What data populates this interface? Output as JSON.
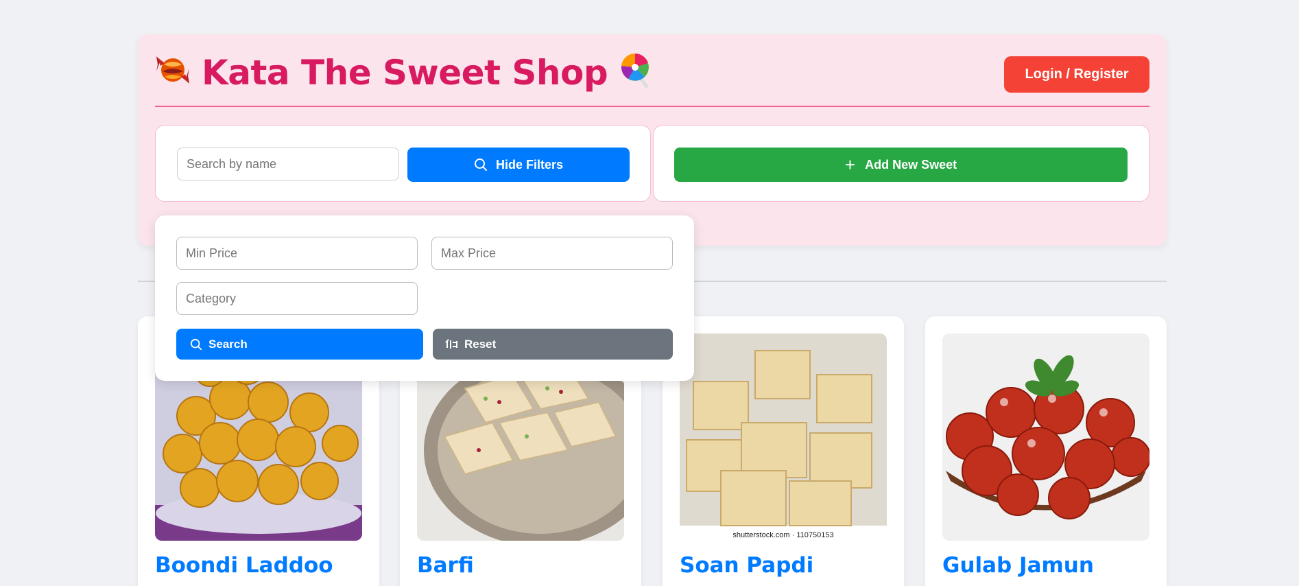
{
  "header": {
    "title": "Kata The Sweet Shop",
    "title_left_icon": "candy-icon",
    "title_right_icon": "lollipop-icon",
    "login_label": "Login / Register"
  },
  "search": {
    "placeholder": "Search by name",
    "hide_filters_label": "Hide Filters"
  },
  "add_sweet_label": "Add New Sweet",
  "filters": {
    "min_price_placeholder": "Min Price",
    "max_price_placeholder": "Max Price",
    "category_placeholder": "Category",
    "search_label": "Search",
    "reset_label": "Reset"
  },
  "sweets": [
    {
      "name": "Boondi Laddoo",
      "image": "boondi-laddoo-photo"
    },
    {
      "name": "Barfi",
      "image": "barfi-photo"
    },
    {
      "name": "Soan Papdi",
      "image": "soan-papdi-photo",
      "watermark": "shutterstock.com · 110750153"
    },
    {
      "name": "Gulab Jamun",
      "image": "gulab-jamun-photo"
    }
  ],
  "colors": {
    "page_bg": "#f0f1f4",
    "header_bg": "#fce4ec",
    "title": "#d81b60",
    "login": "#f44336",
    "primary": "#007bff",
    "success": "#28a745",
    "secondary": "#6c757d"
  }
}
